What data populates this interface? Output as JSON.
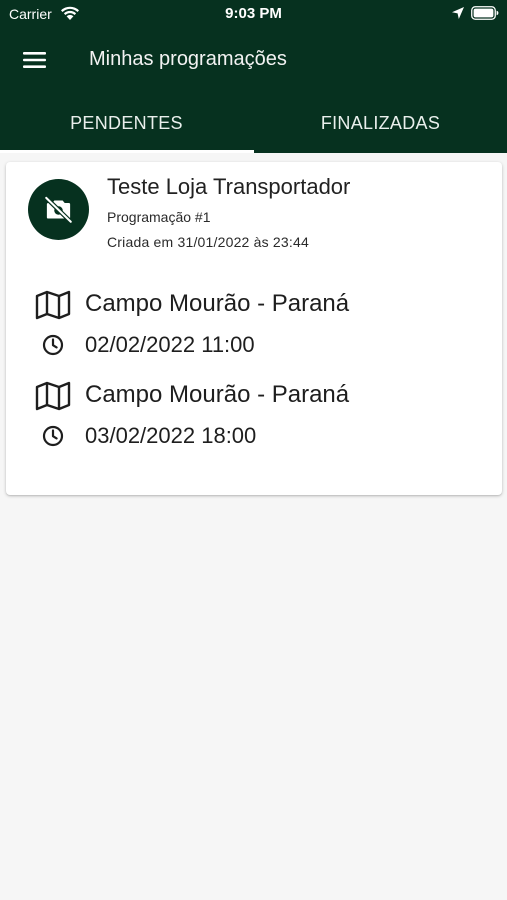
{
  "status_bar": {
    "carrier": "Carrier",
    "time": "9:03 PM",
    "icons": [
      "wifi-icon",
      "location-arrow-icon",
      "battery-icon"
    ]
  },
  "appbar": {
    "title": "Minhas programações",
    "menu_icon": "hamburger-menu-icon"
  },
  "tabs": [
    {
      "label": "PENDENTES",
      "selected": true
    },
    {
      "label": "FINALIZADAS",
      "selected": false
    }
  ],
  "colors": {
    "primary": "#06311f",
    "background": "#f6f6f6",
    "card": "#ffffff"
  },
  "cards": [
    {
      "avatar_icon": "no-photo-icon",
      "title": "Teste Loja Transportador",
      "subtitle": "Programação #1",
      "created": "Criada em 31/01/2022 às 23:44",
      "stops": [
        {
          "city": "Campo Mourão - Paraná",
          "datetime": "02/02/2022 11:00"
        },
        {
          "city": "Campo Mourão - Paraná",
          "datetime": "03/02/2022 18:00"
        }
      ]
    }
  ]
}
